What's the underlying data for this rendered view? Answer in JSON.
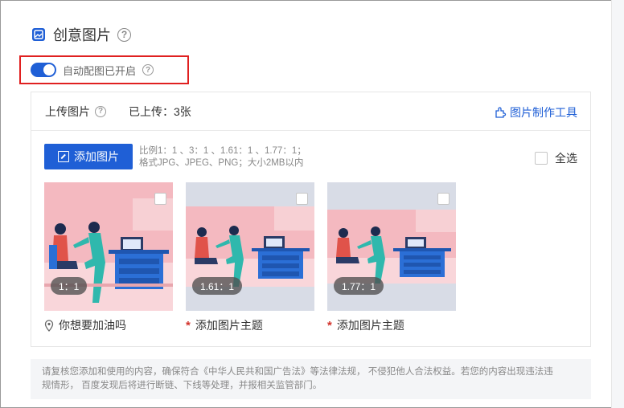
{
  "section": {
    "title": "创意图片",
    "icon": "creative-image-icon"
  },
  "auto_match": {
    "label": "自动配图已开启",
    "enabled": true
  },
  "upload": {
    "label": "上传图片",
    "uploaded_text": "已上传：3张",
    "tool_link": "图片制作工具",
    "add_button": "添加图片",
    "hint_line1": "比例1：1 、3：1 、1.61：1 、1.77：1；",
    "hint_line2": "格式JPG、JPEG、PNG；大小2MB以内",
    "select_all": "全选"
  },
  "cards": [
    {
      "ratio": "1：1",
      "caption": "你想要加油吗",
      "caption_icon": "location-pin-icon",
      "has_theme": true
    },
    {
      "ratio": "1.61：1",
      "caption": "添加图片主题",
      "caption_icon": "required-star",
      "has_theme": false
    },
    {
      "ratio": "1.77：1",
      "caption": "添加图片主题",
      "caption_icon": "required-star",
      "has_theme": false
    }
  ],
  "notice": {
    "line1": "请复核您添加和使用的内容，确保符合《中华人民共和国广告法》等法律法规， 不侵犯他人合法权益。若您的内容出现违法违",
    "line2": "规情形， 百度发现后将进行断链、下线等处理，并报相关监管部门。"
  },
  "colors": {
    "accent": "#1f5fd6",
    "highlight_border": "#e02020",
    "required": "#d2312a"
  }
}
